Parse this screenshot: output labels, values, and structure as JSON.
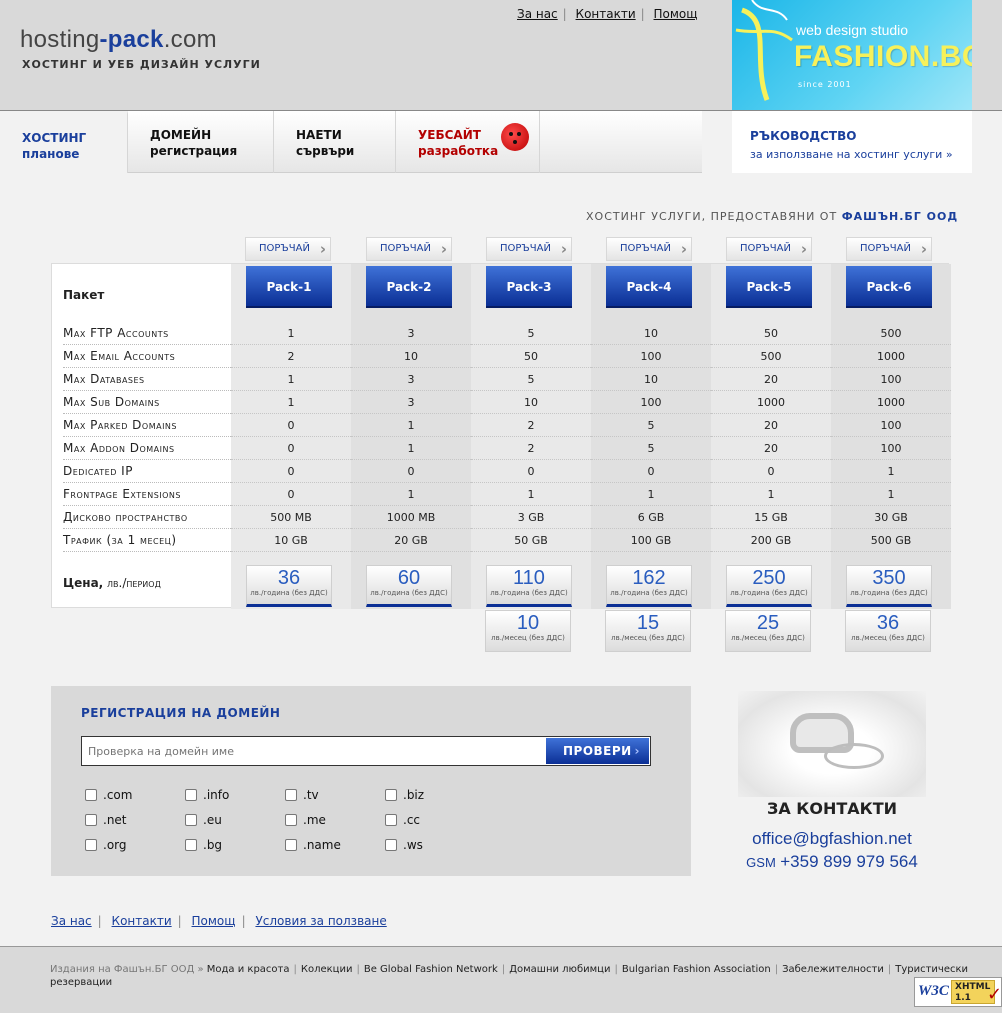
{
  "header": {
    "logo": {
      "part1": "hosting",
      "dash": "-",
      "part2": "pack",
      "part3": ".com"
    },
    "tagline": "ХОСТИНГ И УЕБ ДИЗАЙН УСЛУГИ",
    "top_links": [
      "За нас",
      "Контакти",
      "Помощ"
    ],
    "banner": {
      "line1": "web design studio",
      "line2": "FASHION.BG",
      "line3": "since 2001"
    }
  },
  "nav": {
    "items": [
      {
        "line1": "ХОСТИНГ",
        "line2": "планове"
      },
      {
        "line1": "ДОМЕЙН",
        "line2": "регистрация"
      },
      {
        "line1": "НАЕТИ",
        "line2": "сървъри"
      },
      {
        "line1": "УЕБСАЙТ",
        "line2": "разработка"
      }
    ],
    "guide": {
      "title": "РЪКОВОДСТВО",
      "link": "за използване на хостинг услуги »"
    }
  },
  "provided_by": {
    "text": "ХОСТИНГ УСЛУГИ, ПРЕДОСТАВЯНИ ОТ",
    "company": "ФАШЪН.БГ ООД"
  },
  "pricing": {
    "order_label": "ПОРЪЧАЙ",
    "package_label": "Пакет",
    "packs": [
      "Pack-1",
      "Pack-2",
      "Pack-3",
      "Pack-4",
      "Pack-5",
      "Pack-6"
    ],
    "rows": [
      {
        "label": "Max FTP Accounts",
        "values": [
          "1",
          "3",
          "5",
          "10",
          "50",
          "500"
        ]
      },
      {
        "label": "Max Email Accounts",
        "values": [
          "2",
          "10",
          "50",
          "100",
          "500",
          "1000"
        ]
      },
      {
        "label": "Max Databases",
        "values": [
          "1",
          "3",
          "5",
          "10",
          "20",
          "100"
        ]
      },
      {
        "label": "Max Sub Domains",
        "values": [
          "1",
          "3",
          "10",
          "100",
          "1000",
          "1000"
        ]
      },
      {
        "label": "Max Parked Domains",
        "values": [
          "0",
          "1",
          "2",
          "5",
          "20",
          "100"
        ]
      },
      {
        "label": "Max Addon Domains",
        "values": [
          "0",
          "1",
          "2",
          "5",
          "20",
          "100"
        ]
      },
      {
        "label": "Dedicated IP",
        "values": [
          "0",
          "0",
          "0",
          "0",
          "0",
          "1"
        ]
      },
      {
        "label": "Frontpage Extensions",
        "values": [
          "0",
          "1",
          "1",
          "1",
          "1",
          "1"
        ]
      },
      {
        "label": "Дисково пространство",
        "values": [
          "500 MB",
          "1000 MB",
          "3 GB",
          "6 GB",
          "15 GB",
          "30 GB"
        ]
      },
      {
        "label": "Трафик (за 1 месец)",
        "values": [
          "10 GB",
          "20 GB",
          "50 GB",
          "100 GB",
          "200 GB",
          "500 GB"
        ]
      }
    ],
    "price_label": {
      "bold": "Цена,",
      "rest": " лв./период"
    },
    "yearly_unit": "лв./година (без ДДС)",
    "monthly_unit": "лв./месец (без ДДС)",
    "yearly": [
      "36",
      "60",
      "110",
      "162",
      "250",
      "350"
    ],
    "monthly": [
      "",
      "",
      "10",
      "15",
      "25",
      "36"
    ]
  },
  "domain": {
    "title": "РЕГИСТРАЦИЯ НА ДОМЕЙН",
    "placeholder": "Проверка на домейн име",
    "button": "ПРОВЕРИ",
    "tlds": [
      ".com",
      ".info",
      ".tv",
      ".biz",
      ".net",
      ".eu",
      ".me",
      ".cc",
      ".org",
      ".bg",
      ".name",
      ".ws"
    ]
  },
  "contact": {
    "title": "ЗА КОНТАКТИ",
    "email": "office@bgfashion.net",
    "gsm_label": "GSM",
    "gsm": "+359 899 979 564"
  },
  "bottom_links": [
    "За нас",
    "Контакти",
    "Помощ",
    "Условия за ползване"
  ],
  "footer": {
    "publisher": "Издания на Фашън.БГ ООД »",
    "links": [
      "Мода и красота",
      "Колекции",
      "Be Global Fashion Network",
      "Домашни любимци",
      "Bulgarian Fashion Association",
      "Забележителности",
      "Туристически резервации"
    ]
  },
  "badge": {
    "w3c": "W3C",
    "xhtml": "XHTML",
    "version": "1.1"
  },
  "colors": {
    "accent": "#1a3f9c",
    "red": "#b30000",
    "bg": "#d9d9d9",
    "panel": "#f2f2f2"
  }
}
